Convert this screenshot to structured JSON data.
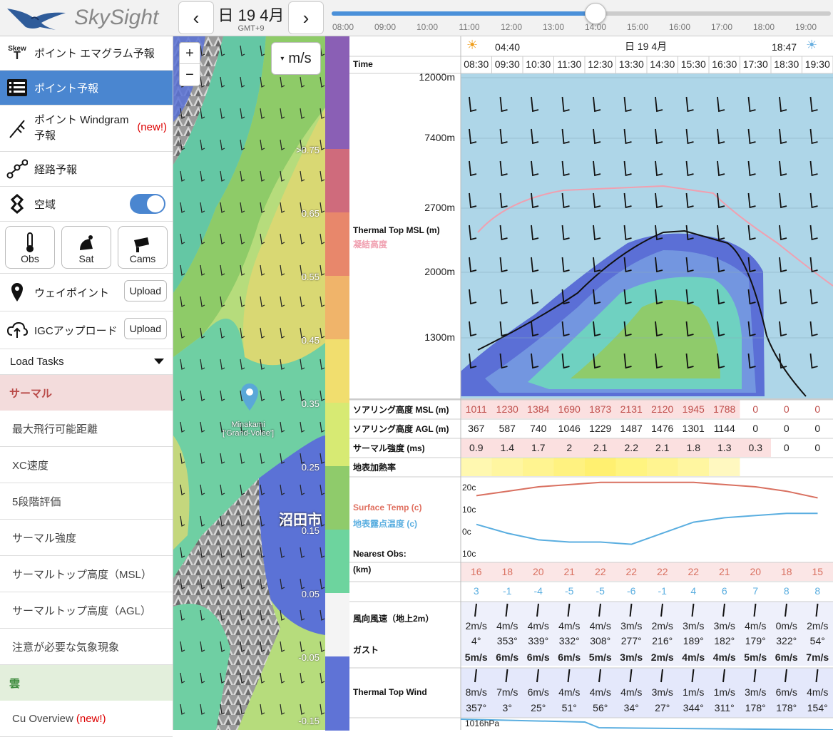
{
  "app": {
    "title": "SkySight"
  },
  "header": {
    "date": "日 19 4月",
    "timezone": "GMT+9",
    "prev": "‹",
    "next": "›",
    "timeline_ticks": [
      "08:00",
      "09:00",
      "10:00",
      "11:00",
      "12:00",
      "13:00",
      "14:00",
      "15:00",
      "16:00",
      "17:00",
      "18:00",
      "19:00"
    ],
    "timeline_selected_fraction": 0.529
  },
  "sidebar": {
    "items": [
      {
        "label": "ポイント エマグラム予報",
        "icon": "skewt-icon"
      },
      {
        "label": "ポイント予報",
        "icon": "list-icon",
        "active": true
      },
      {
        "label": "ポイント Windgram 予報",
        "new": "(new!)",
        "icon": "windgram-icon"
      },
      {
        "label": "経路予報",
        "icon": "route-icon"
      },
      {
        "label": "空域",
        "icon": "airspace-icon",
        "toggle": true
      }
    ],
    "obs_buttons": [
      "Obs",
      "Sat",
      "Cams"
    ],
    "waypoint": {
      "label": "ウェイポイント",
      "button": "Upload"
    },
    "igc": {
      "label": "IGCアップロード",
      "button": "Upload"
    },
    "load_tasks": "Load Tasks",
    "thermal_section": "サーマル",
    "thermal_items": [
      "最大飛行可能距離",
      "XC速度",
      "5段階評価",
      "サーマル強度",
      "サーマルトップ高度（MSL）",
      "サーマルトップ高度（AGL）",
      "注意が必要な気象現象"
    ],
    "cloud_section": "雲",
    "cloud_items": [
      {
        "label": "Cu Overview",
        "new": "(new!)"
      }
    ]
  },
  "map": {
    "zoom_in": "+",
    "zoom_out": "−",
    "unit": "m/s",
    "place_name": "Minakami",
    "place_sub": "['Grand-Volee']",
    "city": "沼田市",
    "scale_labels": [
      ">0.75",
      "0.65",
      "0.55",
      "0.45",
      "0.35",
      "0.25",
      "0.15",
      "0.05",
      "-0.05",
      "-0.15"
    ]
  },
  "legend": {
    "colors": [
      "#8a5fb5",
      "#cf6b7c",
      "#e8876b",
      "#f0b46a",
      "#f1de6e",
      "#d7ea73",
      "#8fcb6b",
      "#6dd49e",
      "#f4f4f4",
      "#5f73d6"
    ]
  },
  "forecast": {
    "sunrise": "04:40",
    "sunset": "18:47",
    "date": "日 19 4月",
    "time_label": "Time",
    "times": [
      "08:30",
      "09:30",
      "10:30",
      "11:30",
      "12:30",
      "13:30",
      "14:30",
      "15:30",
      "16:30",
      "17:30",
      "18:30",
      "19:30"
    ],
    "altitudes": [
      "12000m",
      "7400m",
      "2700m",
      "2000m",
      "1300m"
    ],
    "thermal_top_label": "Thermal Top MSL (m)",
    "freezing_label": "凝結高度",
    "rows": {
      "soaring_msl": {
        "label": "ソアリング高度 MSL (m)",
        "values": [
          "1011",
          "1230",
          "1384",
          "1690",
          "1873",
          "2131",
          "2120",
          "1945",
          "1788",
          "0",
          "0",
          "0"
        ]
      },
      "soaring_agl": {
        "label": "ソアリング高度 AGL (m)",
        "values": [
          "367",
          "587",
          "740",
          "1046",
          "1229",
          "1487",
          "1476",
          "1301",
          "1144",
          "0",
          "0",
          "0"
        ]
      },
      "thermal_strength": {
        "label": "サーマル強度 (ms)",
        "values": [
          "0.9",
          "1.4",
          "1.7",
          "2",
          "2.1",
          "2.2",
          "2.1",
          "1.8",
          "1.3",
          "0.3",
          "0",
          "0"
        ]
      },
      "heating": {
        "label": "地表加熱率"
      }
    },
    "temp_chart": {
      "surface_label": "Surface Temp (c)",
      "dew_label": "地表露点温度 (c)",
      "axis": [
        "20c",
        "10c",
        "0c",
        "10c"
      ],
      "surface": [
        16,
        18,
        20,
        21,
        22,
        22,
        22,
        22,
        21,
        20,
        18,
        15
      ],
      "dew": [
        3,
        -1,
        -4,
        -5,
        -5,
        -6,
        -1,
        4,
        6,
        7,
        8,
        8
      ]
    },
    "nearest_obs": {
      "label": "Nearest Obs:",
      "unit": "(km)",
      "temps": [
        "16",
        "18",
        "20",
        "21",
        "22",
        "22",
        "22",
        "22",
        "21",
        "20",
        "18",
        "15"
      ],
      "dews": [
        "3",
        "-1",
        "-4",
        "-5",
        "-5",
        "-6",
        "-1",
        "4",
        "6",
        "7",
        "8",
        "8"
      ]
    },
    "wind2m": {
      "label": "風向風速（地上2m）",
      "gust_label": "ガスト",
      "speed": [
        "2m/s",
        "4m/s",
        "4m/s",
        "4m/s",
        "4m/s",
        "3m/s",
        "2m/s",
        "3m/s",
        "3m/s",
        "4m/s",
        "0m/s",
        "2m/s"
      ],
      "dir": [
        "4°",
        "353°",
        "339°",
        "332°",
        "308°",
        "277°",
        "216°",
        "189°",
        "182°",
        "179°",
        "322°",
        "54°"
      ],
      "gust": [
        "5m/s",
        "6m/s",
        "6m/s",
        "6m/s",
        "5m/s",
        "3m/s",
        "2m/s",
        "4m/s",
        "4m/s",
        "5m/s",
        "6m/s",
        "7m/s"
      ]
    },
    "thermal_top_wind": {
      "label": "Thermal Top Wind",
      "speed": [
        "8m/s",
        "7m/s",
        "6m/s",
        "4m/s",
        "4m/s",
        "4m/s",
        "3m/s",
        "1m/s",
        "1m/s",
        "3m/s",
        "6m/s",
        "4m/s"
      ],
      "dir": [
        "357°",
        "3°",
        "25°",
        "51°",
        "56°",
        "34°",
        "27°",
        "344°",
        "311°",
        "178°",
        "178°",
        "154°"
      ]
    },
    "pressure": "1016hPa"
  }
}
